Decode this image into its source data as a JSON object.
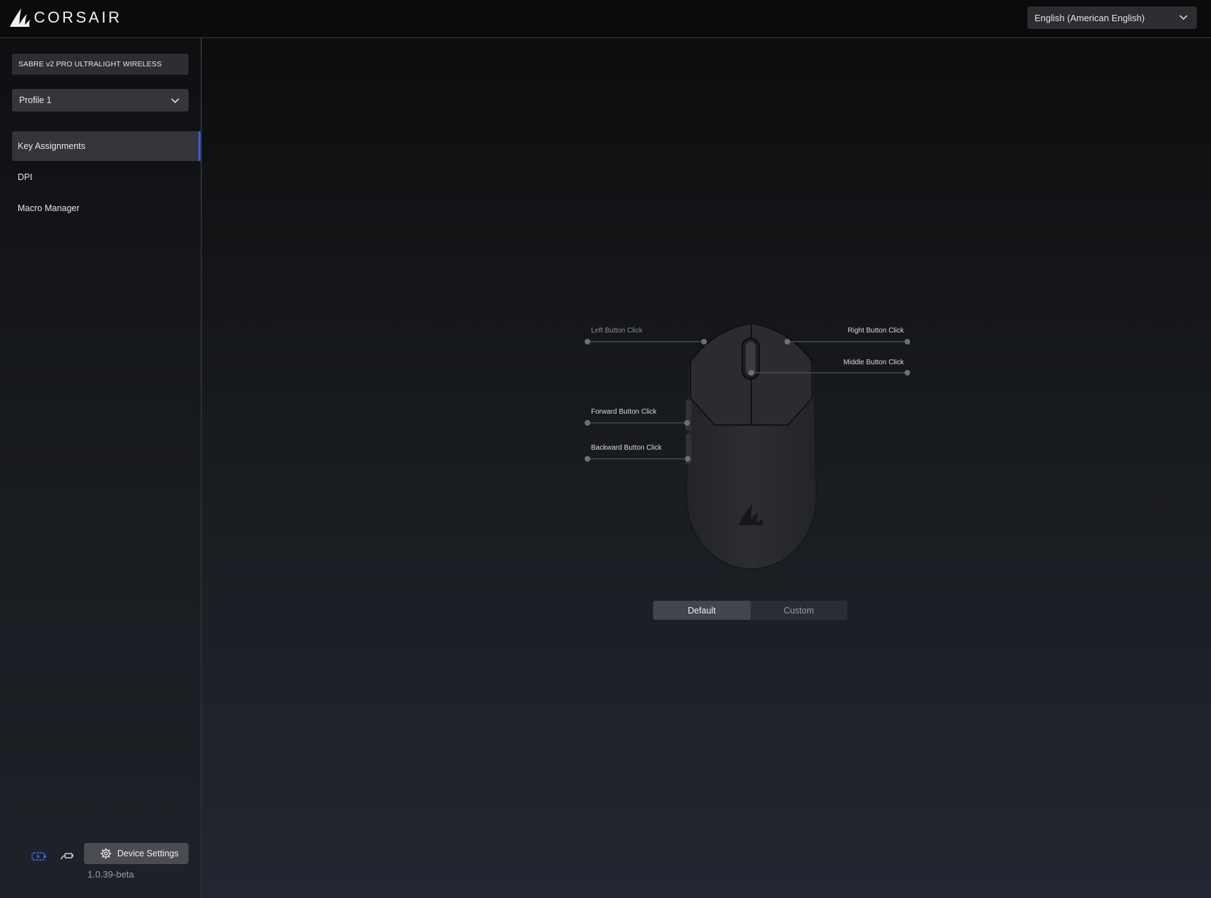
{
  "header": {
    "brand": "CORSAIR",
    "language_select": "English (American English)"
  },
  "sidebar": {
    "device_name": "SABRE v2 PRO ULTRALIGHT WIRELESS",
    "profile_select": "Profile 1",
    "nav": [
      {
        "label": "Key Assignments",
        "active": true
      },
      {
        "label": "DPI",
        "active": false
      },
      {
        "label": "Macro Manager",
        "active": false
      }
    ],
    "footer": {
      "battery_icon": "battery-charging-icon",
      "connection_icon": "wireless-dongle-icon",
      "device_settings_label": "Device Settings",
      "version": "1.0.39-beta"
    }
  },
  "main": {
    "callouts": {
      "left": "Left Button Click",
      "right": "Right Button Click",
      "middle": "Middle Button Click",
      "forward": "Forward Button Click",
      "backward": "Backward Button Click"
    },
    "mode_toggle": {
      "default_label": "Default",
      "custom_label": "Custom",
      "selected": "Default"
    }
  },
  "colors": {
    "accent": "#3b5bd8",
    "panel": "#2d2e32",
    "mouse_body": "#2a2b2e"
  }
}
